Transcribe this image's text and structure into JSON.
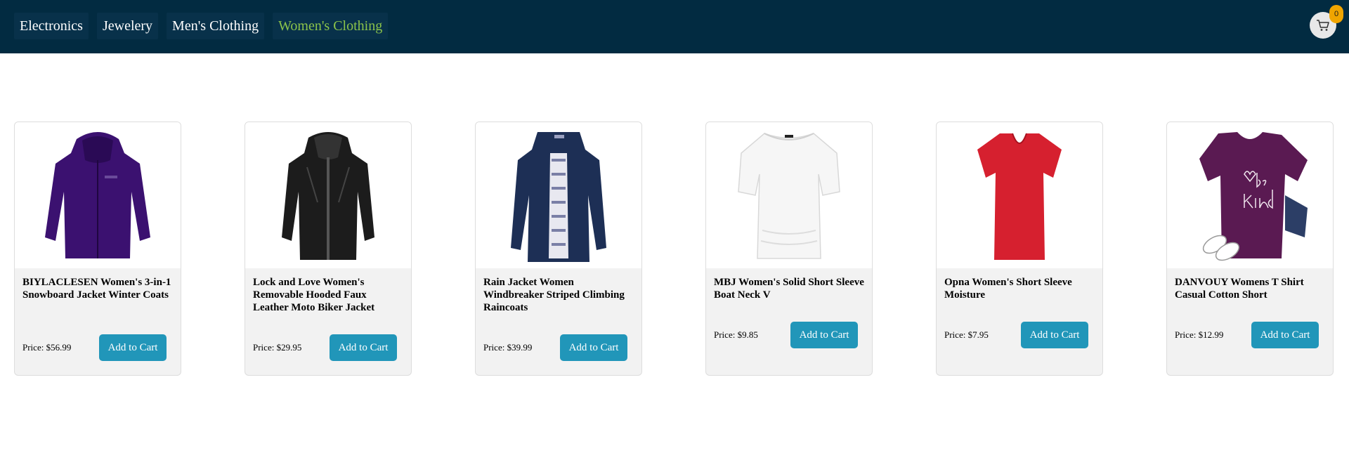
{
  "nav": {
    "tabs": [
      {
        "label": "Electronics"
      },
      {
        "label": "Jewelery"
      },
      {
        "label": "Men's Clothing"
      },
      {
        "label": "Women's Clothing"
      }
    ],
    "active_color": "#8bc34a",
    "background": "#022b41"
  },
  "cart": {
    "icon": "cart-icon",
    "count": "0"
  },
  "products": [
    {
      "title": "BIYLACLESEN Women's 3-in-1 Snowboard Jacket Winter Coats",
      "price": "Price: $56.99",
      "button": "Add to Cart",
      "image": "purple-winter-jacket"
    },
    {
      "title": "Lock and Love Women's Removable Hooded Faux Leather Moto Biker Jacket",
      "price": "Price: $29.95",
      "button": "Add to Cart",
      "image": "black-leather-jacket"
    },
    {
      "title": "Rain Jacket Women Windbreaker Striped Climbing Raincoats",
      "price": "Price: $39.99",
      "button": "Add to Cart",
      "image": "navy-rain-jacket"
    },
    {
      "title": "MBJ Women's Solid Short Sleeve Boat Neck V",
      "price": "Price: $9.85",
      "button": "Add to Cart",
      "image": "white-boat-neck-top"
    },
    {
      "title": "Opna Women's Short Sleeve Moisture",
      "price": "Price: $7.95",
      "button": "Add to Cart",
      "image": "red-v-neck-shirt"
    },
    {
      "title": "DANVOUY Womens T Shirt Casual Cotton Short",
      "price": "Price: $12.99",
      "button": "Add to Cart",
      "image": "purple-be-kind-tshirt"
    }
  ],
  "colors": {
    "button": "#2196b9",
    "badge": "#f0a500"
  }
}
